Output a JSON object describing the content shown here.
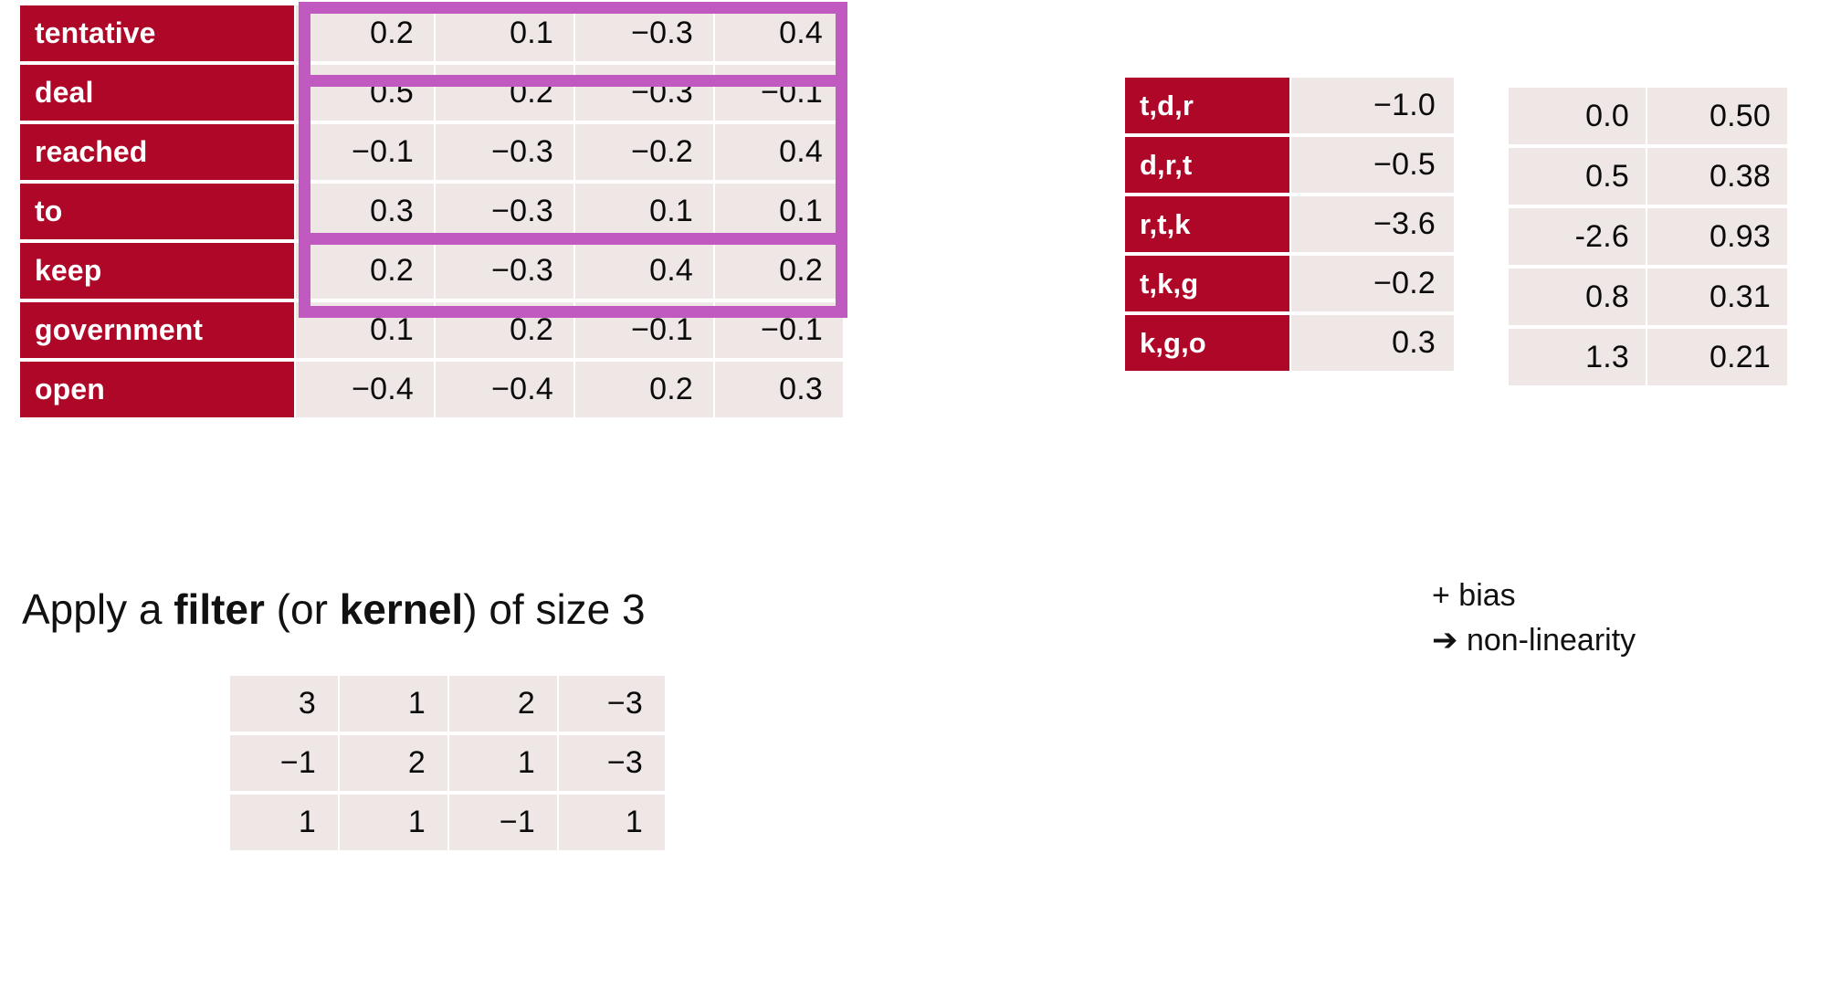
{
  "theme": {
    "label_bg": "#AE0728",
    "label_fg": "#FFFFFF",
    "cell_bg": "#EFE7E6",
    "cell_fg": "#0A0A0A",
    "highlight_border": "#C059C0",
    "page_bg": "#FFFFFF"
  },
  "embedding_table": {
    "name": "word-embedding-matrix",
    "columns": 4,
    "rows": [
      {
        "label": "tentative",
        "values": [
          "0.2",
          "0.1",
          "−0.3",
          "0.4"
        ]
      },
      {
        "label": "deal",
        "values": [
          "0.5",
          "0.2",
          "−0.3",
          "−0.1"
        ]
      },
      {
        "label": "reached",
        "values": [
          "−0.1",
          "−0.3",
          "−0.2",
          "0.4"
        ]
      },
      {
        "label": "to",
        "values": [
          "0.3",
          "−0.3",
          "0.1",
          "0.1"
        ]
      },
      {
        "label": "keep",
        "values": [
          "0.2",
          "−0.3",
          "0.4",
          "0.2"
        ]
      },
      {
        "label": "government",
        "values": [
          "0.1",
          "0.2",
          "−0.1",
          "−0.1"
        ]
      },
      {
        "label": "open",
        "values": [
          "−0.4",
          "−0.4",
          "0.2",
          "0.3"
        ]
      }
    ],
    "highlight_windows": [
      {
        "name": "filter-window-tentative-deal-reached",
        "rows": [
          "tentative",
          "deal",
          "reached"
        ]
      },
      {
        "name": "filter-window-deal-reached-to",
        "rows": [
          "deal",
          "reached",
          "to"
        ]
      }
    ]
  },
  "caption": {
    "prefix": "Apply a ",
    "bold1": "filter",
    "middle": " (or ",
    "bold2": "kernel",
    "suffix": ") of size 3",
    "full_text": "Apply a filter (or kernel) of size 3"
  },
  "kernel_table": {
    "name": "filter-kernel-matrix",
    "rows": [
      [
        "3",
        "1",
        "2",
        "−3"
      ],
      [
        "−1",
        "2",
        "1",
        "−3"
      ],
      [
        "1",
        "1",
        "−1",
        "1"
      ]
    ]
  },
  "conv_output_table": {
    "name": "convolution-output",
    "rows": [
      {
        "label": "t,d,r",
        "value": "−1.0"
      },
      {
        "label": "d,r,t",
        "value": "−0.5"
      },
      {
        "label": "r,t,k",
        "value": "−3.6"
      },
      {
        "label": "t,k,g",
        "value": "−0.2"
      },
      {
        "label": "k,g,o",
        "value": "0.3"
      }
    ]
  },
  "activation_table": {
    "name": "bias-and-nonlinearity-output",
    "rows": [
      {
        "biased": "0.0",
        "activated": "0.50"
      },
      {
        "biased": "0.5",
        "activated": "0.38"
      },
      {
        "biased": "-2.6",
        "activated": "0.93"
      },
      {
        "biased": "0.8",
        "activated": "0.31"
      },
      {
        "biased": "1.3",
        "activated": "0.21"
      }
    ]
  },
  "annotation": {
    "line1": "+ bias",
    "arrow": "➔",
    "line2": "non-linearity"
  }
}
